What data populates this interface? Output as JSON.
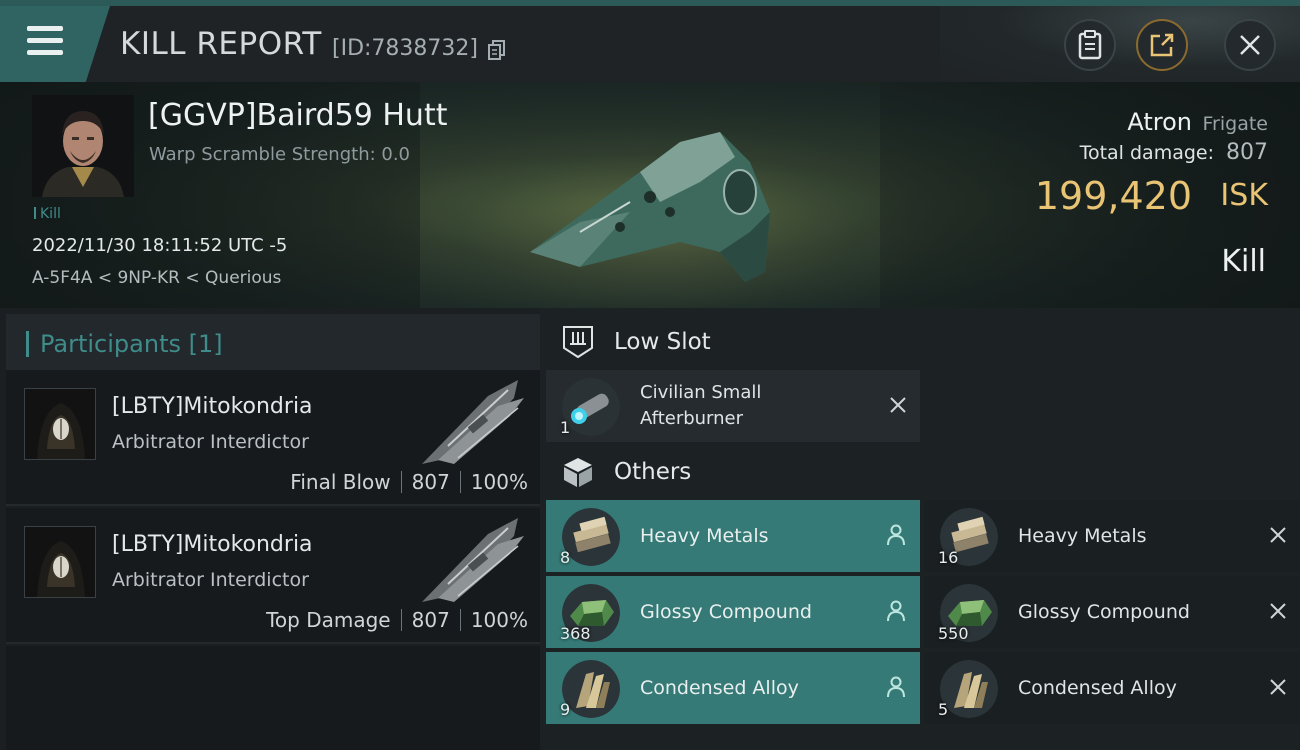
{
  "header": {
    "title": "KILL REPORT",
    "report_id": "[ID:7838732]",
    "icons": [
      "menu-icon",
      "copy-icon",
      "clipboard-icon",
      "share-icon",
      "close-icon"
    ]
  },
  "victim": {
    "name": "[GGVP]Baird59 Hutt",
    "warp_scramble": "Warp Scramble Strength: 0.0",
    "tag": "Kill",
    "datetime": "2022/11/30 18:11:52 UTC -5",
    "location": "A-5F4A < 9NP-KR < Querious",
    "ship_name": "Atron",
    "ship_class": "Frigate",
    "total_damage_label": "Total damage:",
    "total_damage": "807",
    "isk_value": "199,420",
    "isk_unit": "ISK",
    "result": "Kill"
  },
  "participants": {
    "title": "Participants [1]",
    "rows": [
      {
        "name": "[LBTY]Mitokondria",
        "ship": "Arbitrator Interdictor",
        "label": "Final Blow",
        "damage": "807",
        "percent": "100%"
      },
      {
        "name": "[LBTY]Mitokondria",
        "ship": "Arbitrator Interdictor",
        "label": "Top Damage",
        "damage": "807",
        "percent": "100%"
      }
    ]
  },
  "modules": {
    "low_slot": {
      "title": "Low Slot",
      "items": [
        {
          "name": "Civilian Small Afterburner",
          "qty": "1",
          "status": "destroyed"
        }
      ]
    },
    "others": {
      "title": "Others",
      "items": [
        {
          "name": "Heavy Metals",
          "qty": "8",
          "status": "dropped"
        },
        {
          "name": "Heavy Metals",
          "qty": "16",
          "status": "destroyed"
        },
        {
          "name": "Glossy Compound",
          "qty": "368",
          "status": "dropped"
        },
        {
          "name": "Glossy Compound",
          "qty": "550",
          "status": "destroyed"
        },
        {
          "name": "Condensed Alloy",
          "qty": "9",
          "status": "dropped"
        },
        {
          "name": "Condensed Alloy",
          "qty": "5",
          "status": "destroyed"
        }
      ]
    }
  },
  "colors": {
    "accent_teal": "#3f8c8a",
    "dropped_bg": "#357a76",
    "isk_gold": "#e8c474"
  }
}
